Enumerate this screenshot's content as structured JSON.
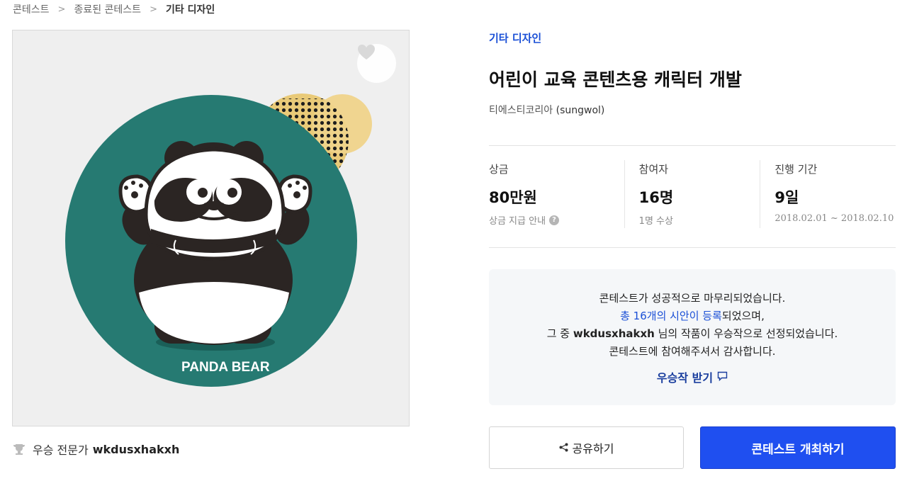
{
  "breadcrumb": {
    "items": [
      "콘테스트",
      "종료된 콘테스트",
      "기타 디자인"
    ]
  },
  "artwork": {
    "caption": "PANDA BEAR",
    "colors": {
      "background": "#efefef",
      "circle": "#267a72",
      "accent": "#e8c56a"
    }
  },
  "winner": {
    "label": "우승 전문가",
    "name": "wkdusxhakxh"
  },
  "contest": {
    "category": "기타 디자인",
    "title": "어린이 교육 콘텐츠용 캐릭터 개발",
    "host": "티에스티코리아",
    "host_id": "(sungwol)"
  },
  "stats": {
    "prize": {
      "label": "상금",
      "value": "80만원",
      "sub": "상금 지급 안내"
    },
    "participants": {
      "label": "참여자",
      "value": "16명",
      "sub": "1명 수상"
    },
    "period": {
      "label": "진행 기간",
      "value": "9일",
      "sub": "2018.02.01 ~ 2018.02.10"
    }
  },
  "notice": {
    "line1": "콘테스트가 성공적으로 마무리되었습니다.",
    "line2_highlight": "총 16개의 시안이 등록",
    "line2_rest": "되었으며,",
    "line3_pre": "그 중 ",
    "line3_name": "wkdusxhakxh",
    "line3_post": " 님의 작품이 우승작으로 선정되었습니다.",
    "line4": "콘테스트에 참여해주셔서 감사합니다.",
    "receive_label": "우승작 받기"
  },
  "actions": {
    "share_label": "공유하기",
    "host_label": "콘테스트 개최하기"
  },
  "colors": {
    "accent_blue": "#1a4fd6",
    "primary_button": "#1f4ff0"
  }
}
